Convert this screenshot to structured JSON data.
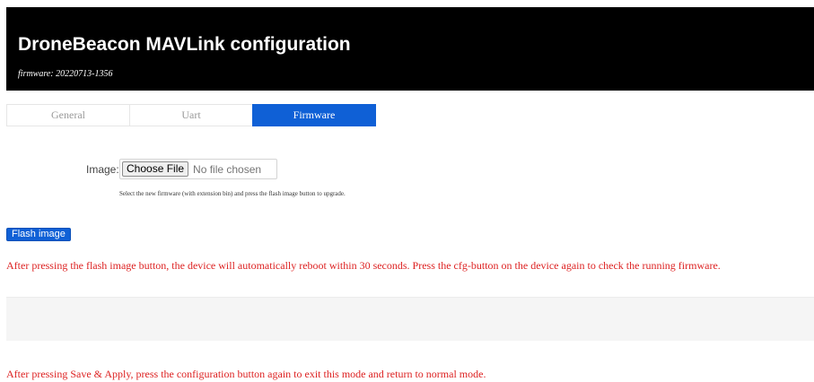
{
  "header": {
    "title": "DroneBeacon MAVLink configuration",
    "firmware": "firmware: 20220713-1356"
  },
  "tabs": [
    {
      "label": "General",
      "active": false
    },
    {
      "label": "Uart",
      "active": false
    },
    {
      "label": "Firmware",
      "active": true
    }
  ],
  "firmware_form": {
    "image_label": "Image:",
    "choose_file_label": "Choose File",
    "no_file_text": "No file chosen",
    "help_text": "Select the new firmware (with extension bin) and press the flash image button to upgrade.",
    "flash_button_label": "Flash image"
  },
  "messages": {
    "flash_warning": "After pressing the flash image button, the device will automatically reboot within 30 seconds. Press the cfg-button on the device again to check the running firmware.",
    "save_warning": "After pressing Save & Apply, press the configuration button again to exit this mode and return to normal mode."
  },
  "colors": {
    "header_bg": "#000000",
    "accent": "#0f60d6",
    "warning_text": "#dd2222"
  }
}
